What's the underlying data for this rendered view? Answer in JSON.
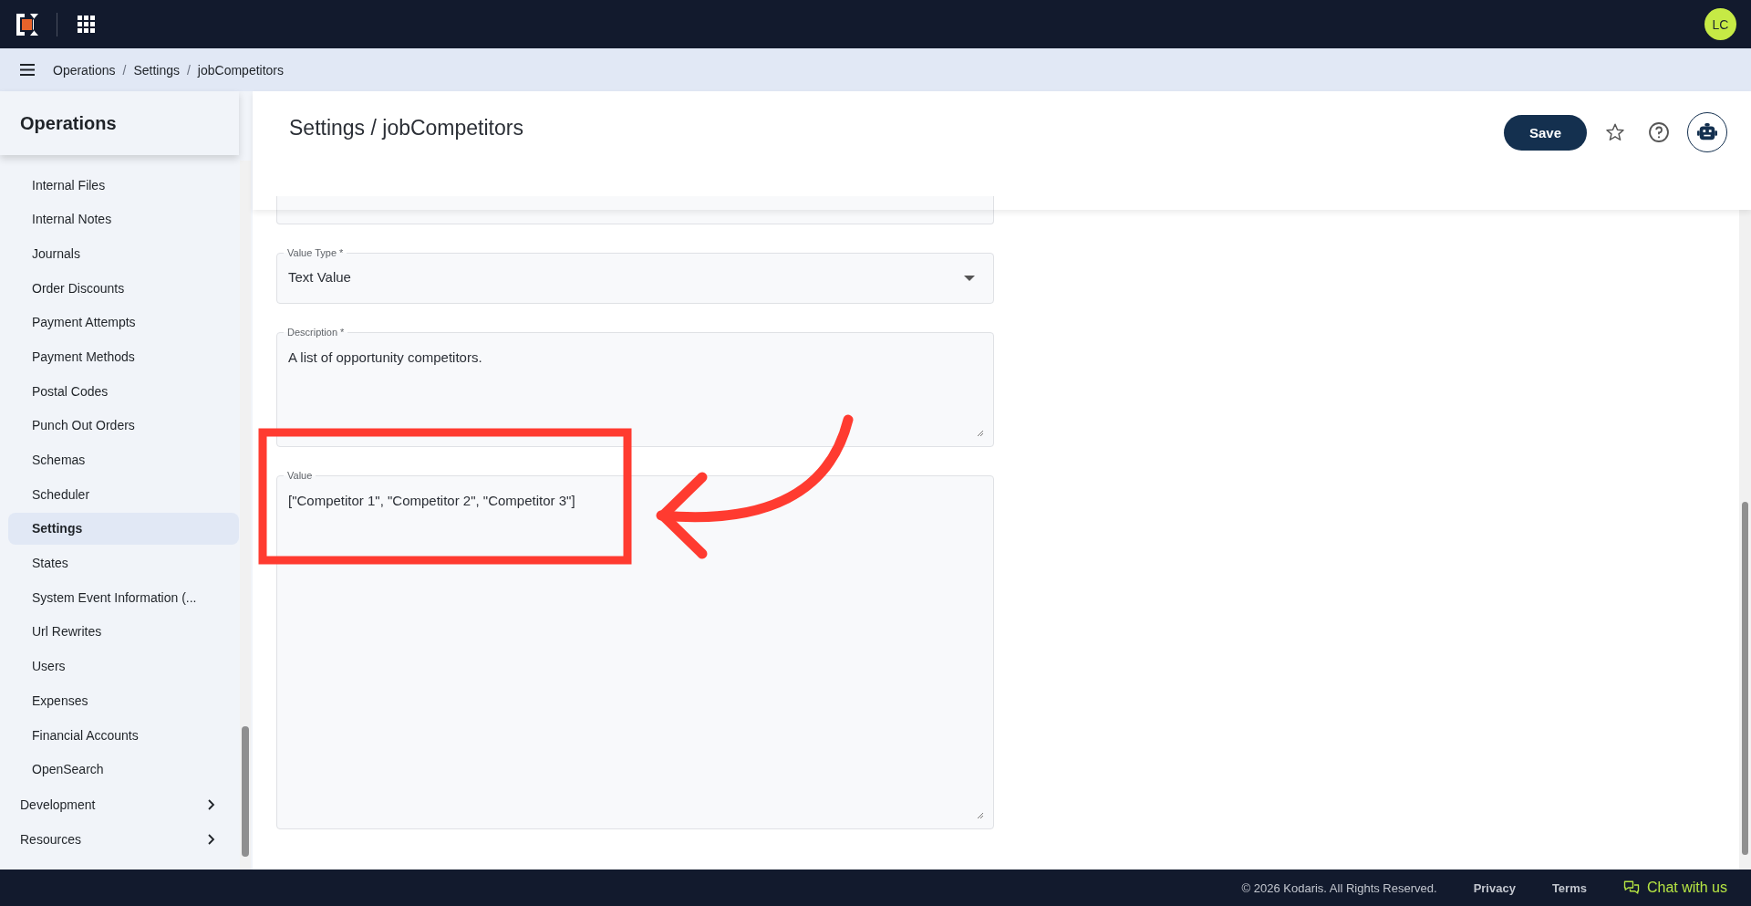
{
  "topbar": {
    "avatar": "LC"
  },
  "breadcrumb": {
    "items": [
      "Operations",
      "Settings",
      "jobCompetitors"
    ],
    "separator": "/"
  },
  "sidebar": {
    "title": "Operations",
    "items": [
      {
        "label": "Internal Files",
        "selected": false
      },
      {
        "label": "Internal Notes",
        "selected": false
      },
      {
        "label": "Journals",
        "selected": false
      },
      {
        "label": "Order Discounts",
        "selected": false
      },
      {
        "label": "Payment Attempts",
        "selected": false
      },
      {
        "label": "Payment Methods",
        "selected": false
      },
      {
        "label": "Postal Codes",
        "selected": false
      },
      {
        "label": "Punch Out Orders",
        "selected": false
      },
      {
        "label": "Schemas",
        "selected": false
      },
      {
        "label": "Scheduler",
        "selected": false
      },
      {
        "label": "Settings",
        "selected": true
      },
      {
        "label": "States",
        "selected": false
      },
      {
        "label": "System Event Information (...",
        "selected": false
      },
      {
        "label": "Url Rewrites",
        "selected": false
      },
      {
        "label": "Users",
        "selected": false
      },
      {
        "label": "Expenses",
        "selected": false
      },
      {
        "label": "Financial Accounts",
        "selected": false
      },
      {
        "label": "OpenSearch",
        "selected": false
      }
    ],
    "sections": [
      {
        "label": "Development",
        "expanded": false
      },
      {
        "label": "Resources",
        "expanded": false
      }
    ]
  },
  "page": {
    "title": "Settings / jobCompetitors",
    "save_button": "Save",
    "starred": false
  },
  "form": {
    "fields": [
      {
        "kind": "select",
        "label": "Value Type *",
        "value": "Text Value"
      },
      {
        "kind": "short-text",
        "label": "Description *",
        "value": "A list of opportunity competitors."
      },
      {
        "kind": "long-text",
        "label": "Value",
        "value": "[\"Competitor 1\", \"Competitor 2\", \"Competitor 3\"]"
      }
    ]
  },
  "footer": {
    "copyright": "© 2026 Kodaris. All Rights Reserved.",
    "links": [
      "Privacy",
      "Terms"
    ],
    "chat": "Chat with us"
  }
}
